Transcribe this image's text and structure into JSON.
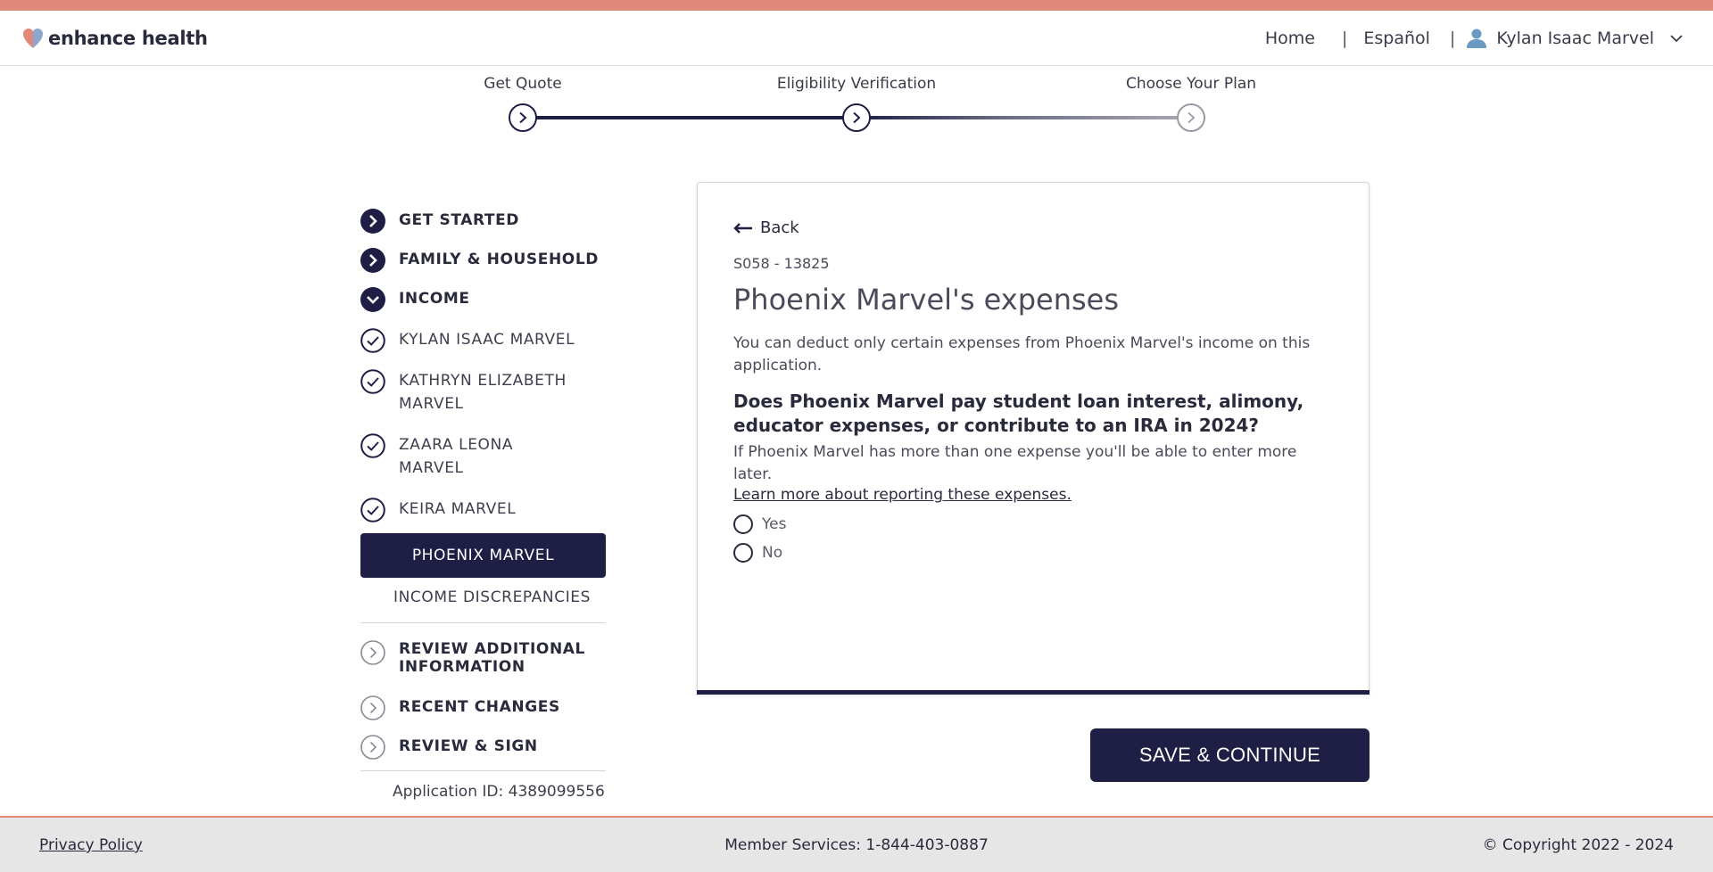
{
  "header": {
    "brand": "enhance health",
    "nav": {
      "home": "Home",
      "separator": "|",
      "language": "Español",
      "user_name": "Kylan Isaac Marvel"
    }
  },
  "progress": {
    "steps": [
      {
        "label": "Get Quote",
        "status": "complete"
      },
      {
        "label": "Eligibility Verification",
        "status": "current"
      },
      {
        "label": "Choose Your Plan",
        "status": "upcoming"
      }
    ]
  },
  "sidebar": {
    "sections": [
      {
        "label": "GET STARTED",
        "icon": "chevron-right-filled-icon"
      },
      {
        "label": "FAMILY & HOUSEHOLD",
        "icon": "chevron-right-filled-icon"
      },
      {
        "label": "INCOME",
        "icon": "chevron-down-filled-icon"
      }
    ],
    "income_members": [
      {
        "label": "KYLAN ISAAC MARVEL",
        "icon": "check-circle-icon"
      },
      {
        "label": "KATHRYN ELIZABETH MARVEL",
        "icon": "check-circle-icon"
      },
      {
        "label": "ZAARA LEONA MARVEL",
        "icon": "check-circle-icon"
      },
      {
        "label": "KEIRA MARVEL",
        "icon": "check-circle-icon"
      }
    ],
    "active_item": "PHOENIX MARVEL",
    "income_discrepancies": "INCOME DISCREPANCIES",
    "later_sections": [
      {
        "label": "REVIEW ADDITIONAL INFORMATION",
        "icon": "chevron-right-outline-icon"
      },
      {
        "label": "RECENT CHANGES",
        "icon": "chevron-right-outline-icon"
      },
      {
        "label": "REVIEW & SIGN",
        "icon": "chevron-right-outline-icon"
      }
    ],
    "application_id": "Application ID: 4389099556"
  },
  "card": {
    "back_label": "Back",
    "code": "S058 - 13825",
    "title": "Phoenix Marvel's expenses",
    "description": "You can deduct only certain expenses from Phoenix Marvel's income on this application.",
    "question": "Does Phoenix Marvel pay student loan interest, alimony, educator expenses, or contribute to an IRA in 2024?",
    "hint": "If Phoenix Marvel has more than one expense you'll be able to enter more later.",
    "learn_more": "Learn more about reporting these expenses.",
    "options": [
      "Yes",
      "No"
    ]
  },
  "save_button": "SAVE & CONTINUE",
  "footer": {
    "privacy": "Privacy Policy",
    "member_services": "Member Services: 1-844-403-0887",
    "copyright": "© Copyright 2022 - 2024"
  },
  "colors": {
    "accent_stripe": "#e0897a",
    "navy": "#1f1f45",
    "text": "#2a2a3d"
  }
}
